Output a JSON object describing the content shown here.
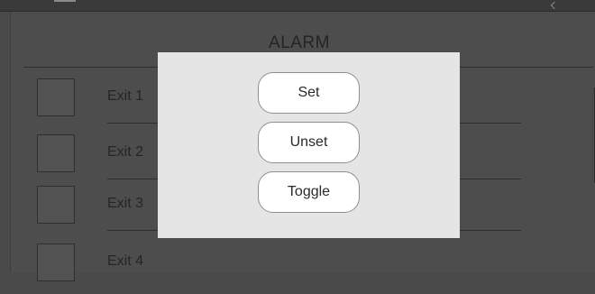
{
  "header": {
    "menu_icon": "menu-icon",
    "chevron_icon": "chevron-icon"
  },
  "page": {
    "title": "ALARM",
    "items": [
      {
        "label": "Exit 1",
        "checked": false
      },
      {
        "label": "Exit 2",
        "checked": false
      },
      {
        "label": "Exit 3",
        "checked": false
      },
      {
        "label": "Exit 4",
        "checked": false
      }
    ]
  },
  "dialog": {
    "buttons": [
      {
        "label": "Set"
      },
      {
        "label": "Unset"
      },
      {
        "label": "Toggle"
      }
    ]
  },
  "colors": {
    "background": "#4a4a4a",
    "dialog_background": "#e5e5e5",
    "button_background": "#ffffff",
    "button_border": "#8e8e8e"
  }
}
